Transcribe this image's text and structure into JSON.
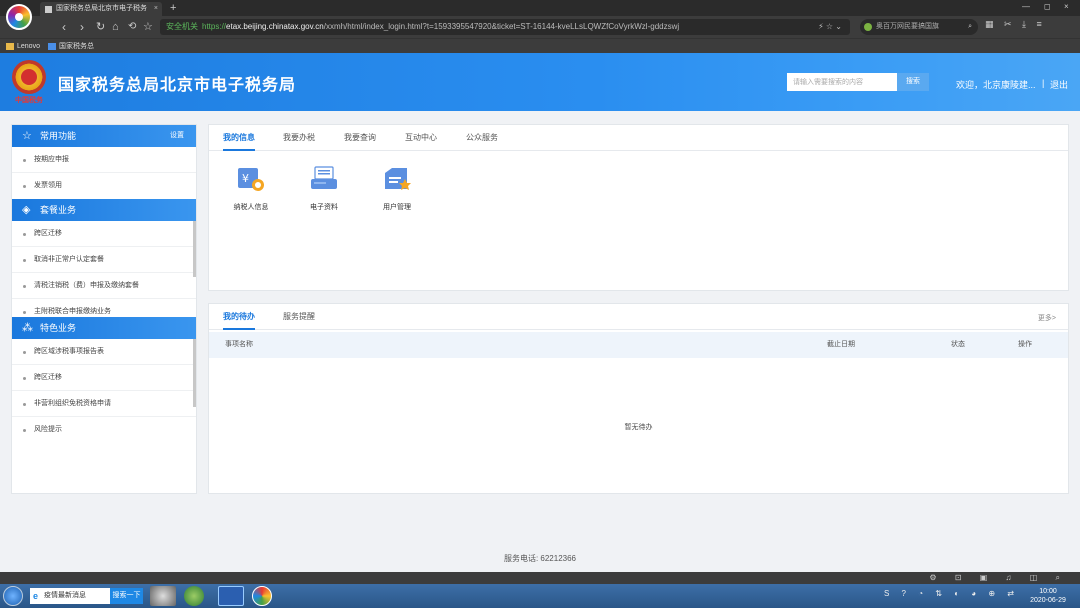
{
  "browser": {
    "tab_title": "国家税务总局北京市电子税务",
    "tab_close": "×",
    "new_tab": "+",
    "win_controls": [
      "—",
      "◻",
      "×"
    ],
    "nav": {
      "back": "‹",
      "forward": "›",
      "reload": "↻",
      "home": "⌂",
      "undo": "⟲",
      "star": "☆"
    },
    "secure_label": "安全机关",
    "url_scheme": "https://",
    "url_host": "etax.beijing.chinatax.gov.cn",
    "url_path": "/xxmh/html/index_login.html?t=1593395547920&ticket=ST-16144-kveLLsLQWZfCoVyrkWzl-gddzswj",
    "url_icons": "⚡ ☆ ⌄",
    "search_text": "奥百万网民要搞国旗",
    "search_glass": "⌕",
    "toolbar_right": "▦ ✂ ⤓ ≡",
    "bookmarks": [
      "Lenovo",
      "国家税务总"
    ]
  },
  "header": {
    "emblem_text": "中国税务",
    "title": "国家税务总局北京市电子税务局",
    "search_placeholder": "请输入需要搜索的内容",
    "search_button": "搜索",
    "welcome": "欢迎，北京康陵建...",
    "separator": "|",
    "logout": "退出"
  },
  "sidebar": {
    "groups": [
      {
        "title": "常用功能",
        "icon": "☆",
        "action": "设置",
        "items": [
          "按期应申报",
          "发票领用"
        ]
      },
      {
        "title": "套餐业务",
        "icon": "◈",
        "items": [
          "跨区迁移",
          "取消非正常户认定套餐",
          "清税注销税（费）申报及缴纳套餐",
          "主附税联合申报缴纳业务"
        ]
      },
      {
        "title": "特色业务",
        "icon": "⁂",
        "items": [
          "跨区域涉税事项报告表",
          "跨区迁移",
          "非营利组织免税资格申请",
          "风险提示"
        ]
      }
    ]
  },
  "main": {
    "tabs": [
      "我的信息",
      "我要办税",
      "我要查询",
      "互动中心",
      "公众服务"
    ],
    "functions": [
      "纳税人信息",
      "电子资料",
      "用户管理"
    ],
    "todo": {
      "tabs": [
        "我的待办",
        "服务提醒"
      ],
      "more": "更多>",
      "columns": [
        "事项名称",
        "截止日期",
        "状态",
        "操作"
      ],
      "empty": "暂无待办"
    }
  },
  "footer": {
    "phone": "服务电话: 62212366"
  },
  "statusbar": {
    "icons": "⚙ ⊡ ▣ ♫ ◫ ⌕"
  },
  "taskbar": {
    "input_text": "疫情最新消息",
    "ie_icon": "e",
    "search_button": "搜索一下",
    "tray": "S ? ◔ ⇅ ◐ ◕ ⊕ ⇄",
    "clock_time": "10:00",
    "clock_date": "2020-06-29"
  },
  "colors": {
    "brand": "#1a78dd",
    "header": "#2a8ef0",
    "background": "#f0f2f5"
  }
}
